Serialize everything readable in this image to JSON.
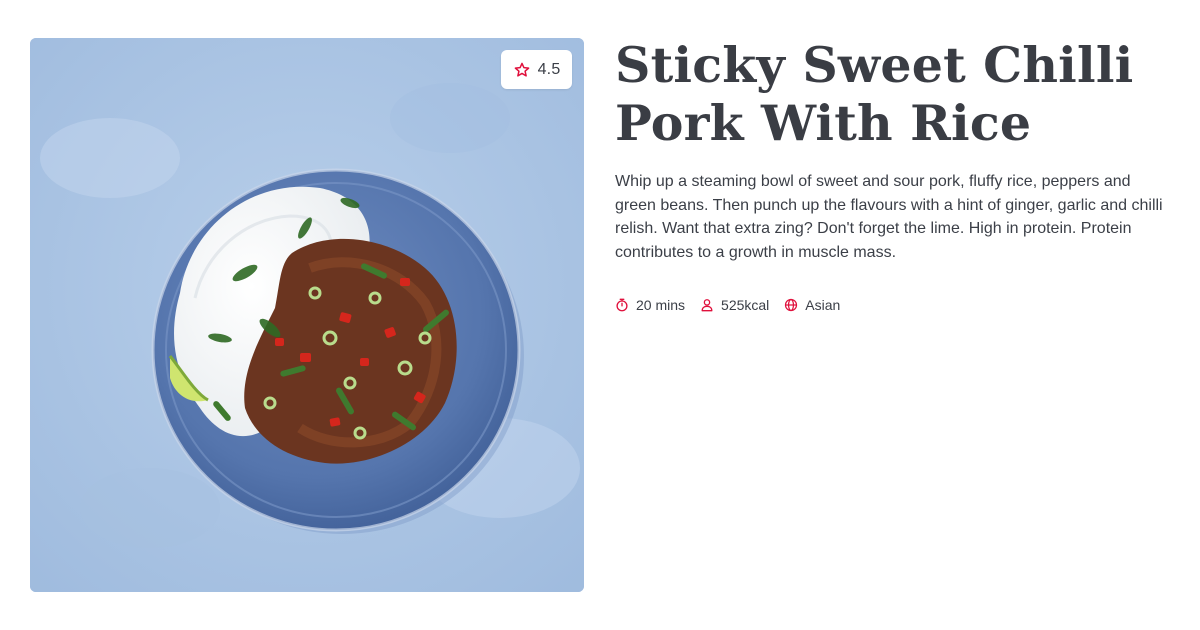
{
  "recipe": {
    "title": "Sticky Sweet Chilli Pork With Rice",
    "description": "Whip up a steaming bowl of sweet and sour pork, fluffy rice, peppers and green beans. Then punch up the flavours with a hint of ginger, garlic and chilli relish. Want that extra zing? Don't forget the lime. High in protein. Protein contributes to a growth in muscle mass.",
    "rating": "4.5",
    "image_alt": "Sticky Sweet Chilli Pork With Rice"
  },
  "meta": {
    "time": "20 mins",
    "calories": "525kcal",
    "cuisine": "Asian"
  },
  "icons": {
    "rating": "star-icon",
    "time": "stopwatch-icon",
    "calories": "person-icon",
    "cuisine": "globe-icon"
  },
  "colors": {
    "accent": "#e0103c",
    "title": "#3a3d44",
    "text": "#3b3f47",
    "background_surface": "#a9c3e2",
    "plate": "#5273aa"
  }
}
